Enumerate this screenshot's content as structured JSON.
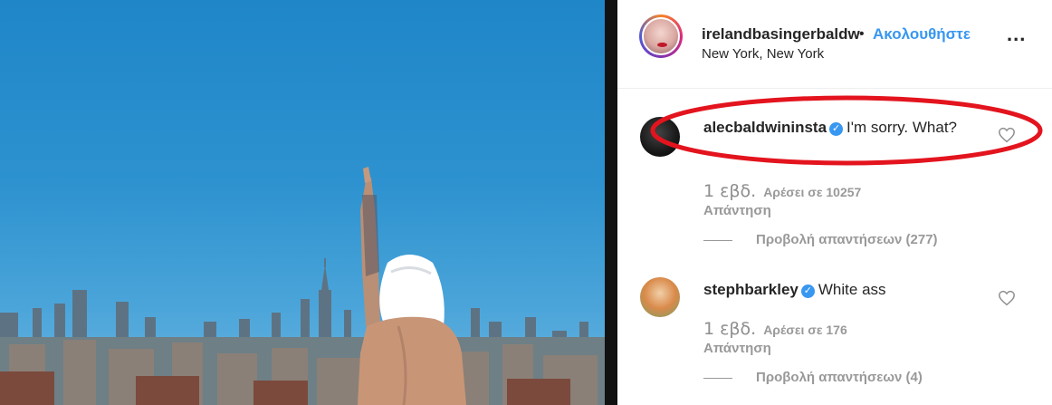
{
  "post": {
    "username": "irelandbasingerbaldwin",
    "separator": "•",
    "follow_label": "Ακολουθήστε",
    "location": "New York, New York",
    "more_label": "..."
  },
  "comments": [
    {
      "username": "alecbaldwininsta",
      "verified_mark": "✓",
      "text": "I'm sorry. What?",
      "age": "1 εβδ.",
      "likes": "Αρέσει σε 10257",
      "reply_label": "Απάντηση",
      "view_replies": "Προβολή απαντήσεων (277)"
    },
    {
      "username": "stephbarkley",
      "verified_mark": "✓",
      "text": "White ass",
      "age": "1 εβδ.",
      "likes": "Αρέσει σε 176",
      "reply_label": "Απάντηση",
      "view_replies": "Προβολή απαντήσεων (4)"
    }
  ],
  "colors": {
    "link_blue": "#3897f0",
    "annotation_red": "#e3141e",
    "sky": "#2d92cf"
  }
}
